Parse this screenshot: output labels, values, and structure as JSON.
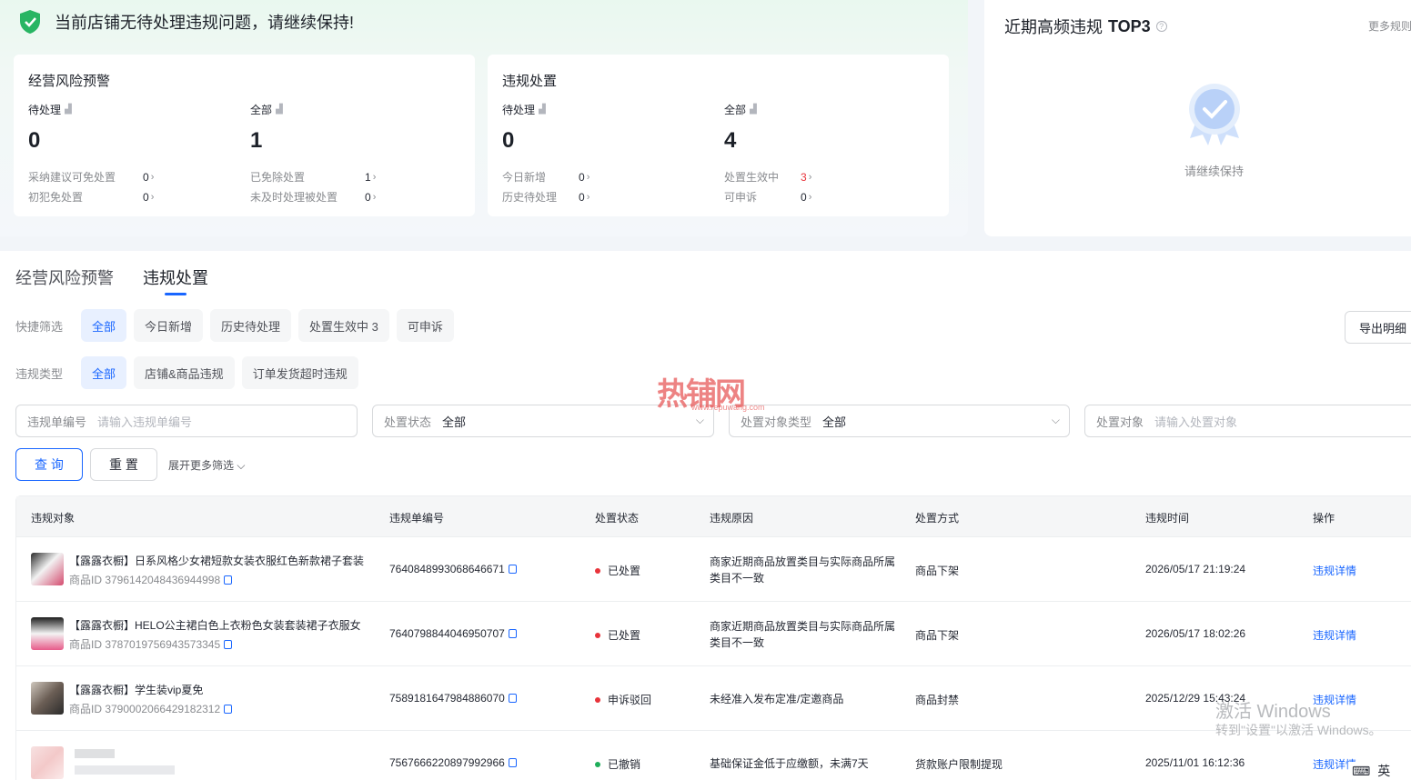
{
  "banner": {
    "text": "当前店铺无待处理违规问题，请继续保持!"
  },
  "risk_card": {
    "title": "经营风险预警",
    "pending_label": "待处理",
    "pending_value": "0",
    "all_label": "全部",
    "all_value": "1",
    "rows": [
      {
        "label": "采纳建议可免处置",
        "value": "0"
      },
      {
        "label": "初犯免处置",
        "value": "0"
      },
      {
        "label": "已免除处置",
        "value": "1"
      },
      {
        "label": "未及时处理被处置",
        "value": "0"
      }
    ]
  },
  "violation_card": {
    "title": "违规处置",
    "pending_label": "待处理",
    "pending_value": "0",
    "all_label": "全部",
    "all_value": "4",
    "rows": [
      {
        "label": "今日新增",
        "value": "0"
      },
      {
        "label": "历史待处理",
        "value": "0"
      },
      {
        "label": "处置生效中",
        "value": "3"
      },
      {
        "label": "可申诉",
        "value": "0"
      }
    ]
  },
  "top3": {
    "title_prefix": "近期高频违规",
    "title_bold": "TOP3",
    "more": "更多规则",
    "empty": "请继续保持"
  },
  "tabs": [
    "经营风险预警",
    "违规处置"
  ],
  "quick_filter": {
    "label": "快捷筛选",
    "chips": [
      "全部",
      "今日新增",
      "历史待处理",
      "处置生效中 3",
      "可申诉"
    ]
  },
  "type_filter": {
    "label": "违规类型",
    "chips": [
      "全部",
      "店铺&商品违规",
      "订单发货超时违规"
    ]
  },
  "export_label": "导出明细",
  "fields": {
    "order_no": {
      "label": "违规单编号",
      "placeholder": "请输入违规单编号"
    },
    "status": {
      "label": "处置状态",
      "value": "全部"
    },
    "target_type": {
      "label": "处置对象类型",
      "value": "全部"
    },
    "target": {
      "label": "处置对象",
      "placeholder": "请输入处置对象"
    }
  },
  "buttons": {
    "query": "查 询",
    "reset": "重 置",
    "expand": "展开更多筛选"
  },
  "table": {
    "headers": [
      "违规对象",
      "违规单编号",
      "处置状态",
      "违规原因",
      "处置方式",
      "违规时间",
      "操作"
    ],
    "rows": [
      {
        "title": "【露露衣橱】日系风格少女裙短款女装衣服红色新款裙子套装",
        "product_id": "商品ID 3796142048436944998",
        "order_no": "7640848993068646671",
        "status": "已处置",
        "status_color": "#e8333a",
        "reason": "商家近期商品放置类目与实际商品所属类目不一致",
        "method": "商品下架",
        "time": "2026/05/17 21:19:24",
        "op": "违规详情"
      },
      {
        "title": "【露露衣橱】HELO公主裙白色上衣粉色女装套装裙子衣服女",
        "product_id": "商品ID 3787019756943573345",
        "order_no": "7640798844046950707",
        "status": "已处置",
        "status_color": "#e8333a",
        "reason": "商家近期商品放置类目与实际商品所属类目不一致",
        "method": "商品下架",
        "time": "2026/05/17 18:02:26",
        "op": "违规详情"
      },
      {
        "title": "【露露衣橱】学生装vip夏免",
        "product_id": "商品ID 3790002066429182312",
        "order_no": "7589181647984886070",
        "status": "申诉驳回",
        "status_color": "#e8333a",
        "reason": "未经准入发布定准/定邀商品",
        "method": "商品封禁",
        "time": "2025/12/29 15:43:24",
        "op": "违规详情"
      },
      {
        "title": "",
        "product_id": "",
        "order_no": "7567666220897992966",
        "status": "已撤销",
        "status_color": "#1fae5a",
        "reason": "基础保证金低于应缴额，未满7天",
        "method": "货款账户限制提现",
        "time": "2025/11/01 16:12:36",
        "op": "违规详情"
      }
    ]
  },
  "watermark": {
    "main": "热铺网",
    "sub": "www.repuwang.com"
  },
  "windows": {
    "line1": "激活 Windows",
    "line2": "转到\"设置\"以激活 Windows。"
  },
  "ime": {
    "mode": "英"
  },
  "colors": {
    "accent": "#1966ff",
    "success": "#1fae5a",
    "danger": "#e8333a"
  }
}
